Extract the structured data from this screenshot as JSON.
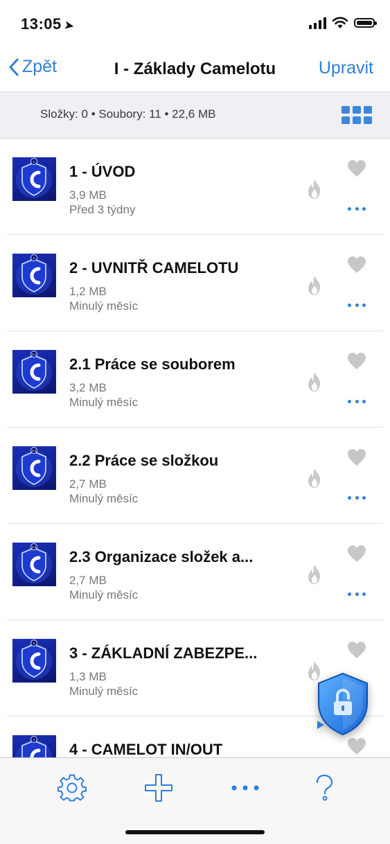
{
  "status_bar": {
    "time": "13:05"
  },
  "nav": {
    "back_label": "Zpět",
    "title": "I - Základy Camelotu",
    "edit_label": "Upravit"
  },
  "summary": {
    "text": "Složky: 0 • Soubory: 11 • 22,6 MB"
  },
  "files": [
    {
      "name": "1 - ÚVOD",
      "size": "3,9 MB",
      "date": "Před 3 týdny",
      "thumb_label": "1"
    },
    {
      "name": "2 - UVNITŘ CAMELOTU",
      "size": "1,2 MB",
      "date": "Minulý měsíc",
      "thumb_label": "2"
    },
    {
      "name": "2.1 Práce se souborem",
      "size": "3,2 MB",
      "date": "Minulý měsíc",
      "thumb_label": "2.1"
    },
    {
      "name": "2.2 Práce se složkou",
      "size": "2,7 MB",
      "date": "Minulý měsíc",
      "thumb_label": "2.2"
    },
    {
      "name": "2.3 Organizace složek a...",
      "size": "2,7 MB",
      "date": "Minulý měsíc",
      "thumb_label": "2.3"
    },
    {
      "name": "3 - ZÁKLADNÍ ZABEZPE...",
      "size": "1,3 MB",
      "date": "Minulý měsíc",
      "thumb_label": "3"
    },
    {
      "name": "4 - CAMELOT IN/OUT",
      "size": "",
      "date": "",
      "thumb_label": "4"
    }
  ],
  "toolbar": {
    "icons": [
      "gear-icon",
      "plus-icon",
      "more-icon",
      "help-icon"
    ]
  },
  "colors": {
    "accent": "#2f7fd9",
    "summary_bg": "#efeff4",
    "thumb_blue": "#1a2fb8"
  }
}
